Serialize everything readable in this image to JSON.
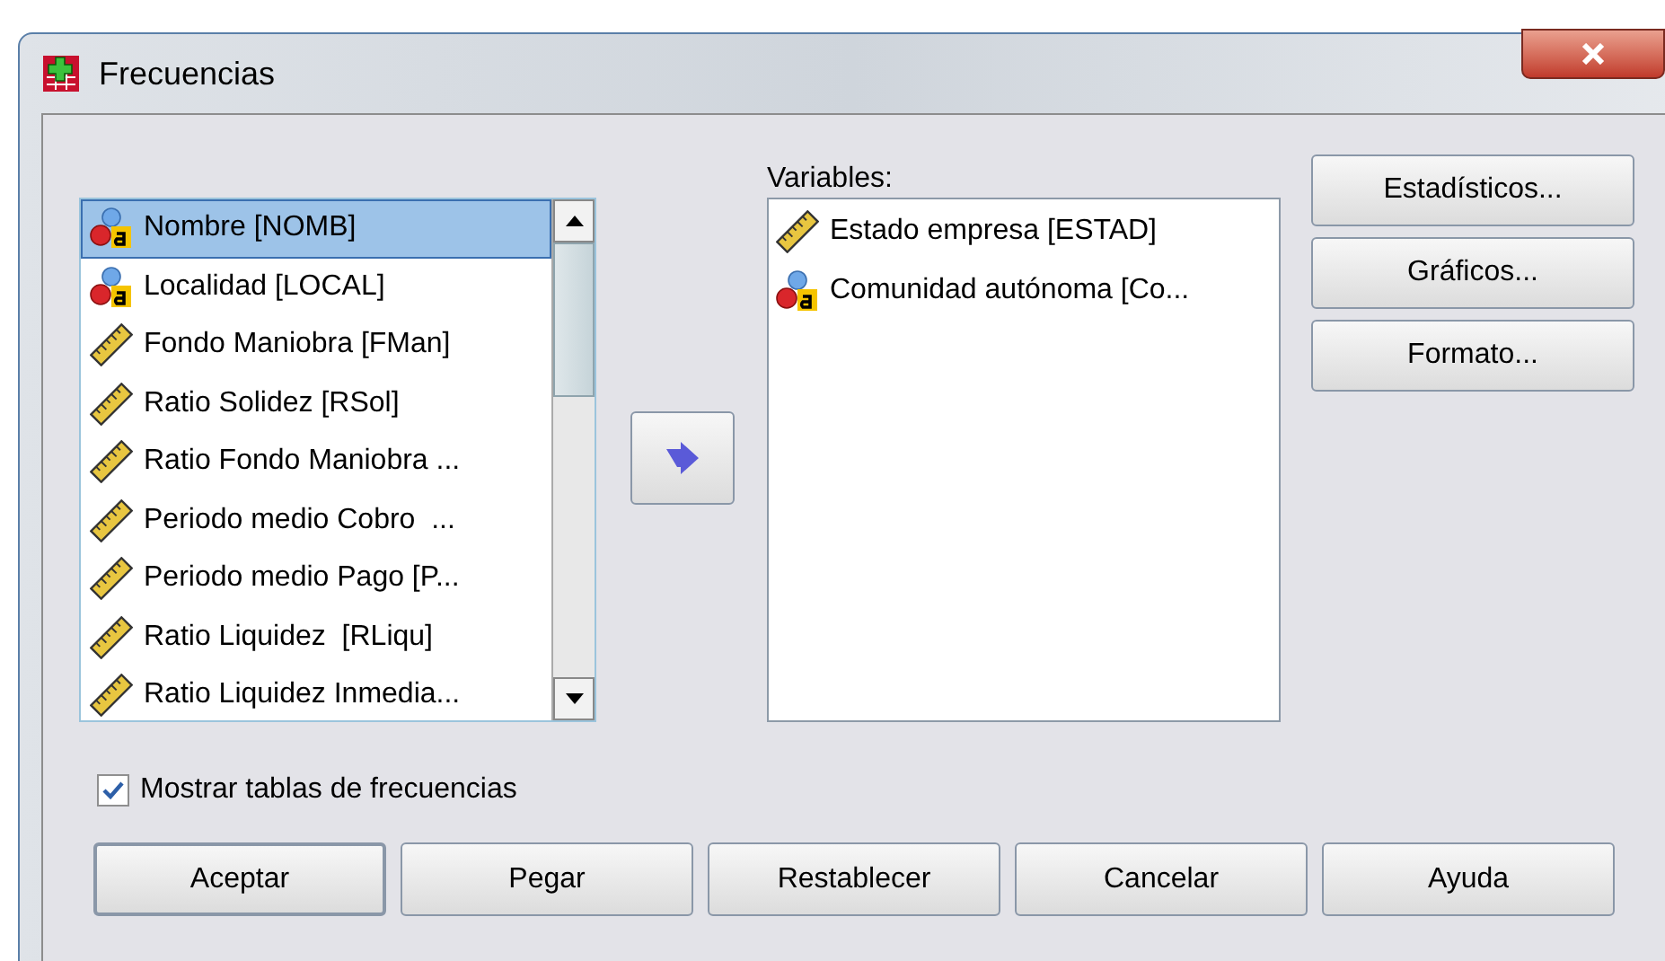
{
  "window": {
    "title": "Frecuencias"
  },
  "source_list": [
    {
      "label": "Nombre [NOMB]",
      "kind": "nominal",
      "selected": true
    },
    {
      "label": "Localidad [LOCAL]",
      "kind": "nominal",
      "selected": false
    },
    {
      "label": "Fondo Maniobra [FMan]",
      "kind": "scale",
      "selected": false
    },
    {
      "label": "Ratio Solidez [RSol]",
      "kind": "scale",
      "selected": false
    },
    {
      "label": "Ratio Fondo Maniobra ...",
      "kind": "scale",
      "selected": false
    },
    {
      "label": "Periodo medio Cobro  ...",
      "kind": "scale",
      "selected": false
    },
    {
      "label": "Periodo medio Pago [P...",
      "kind": "scale",
      "selected": false
    },
    {
      "label": "Ratio Liquidez  [RLiqu]",
      "kind": "scale",
      "selected": false
    },
    {
      "label": "Ratio Liquidez Inmedia...",
      "kind": "scale",
      "selected": false
    }
  ],
  "variables": {
    "label": "Variables:",
    "items": [
      {
        "label": "Estado empresa [ESTAD]",
        "kind": "scale"
      },
      {
        "label": "Comunidad autónoma [Co...",
        "kind": "nominal"
      }
    ]
  },
  "side_buttons": [
    "Estadísticos...",
    "Gráficos...",
    "Formato..."
  ],
  "show_tables": {
    "label": "Mostrar tablas de frecuencias",
    "checked": true
  },
  "buttons": [
    {
      "label": "Aceptar",
      "default": true
    },
    {
      "label": "Pegar",
      "default": false
    },
    {
      "label": "Restablecer",
      "default": false
    },
    {
      "label": "Cancelar",
      "default": false
    },
    {
      "label": "Ayuda",
      "default": false
    }
  ]
}
